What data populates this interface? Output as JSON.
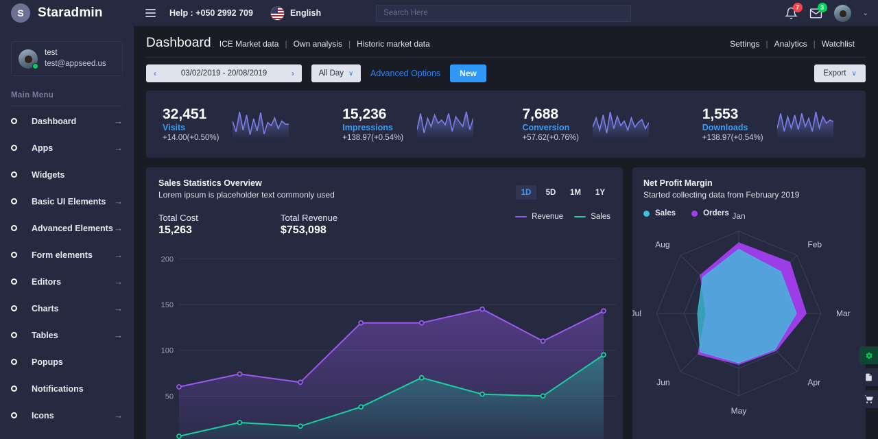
{
  "brand": {
    "logo_letter": "S",
    "name": "Staradmin"
  },
  "profile": {
    "name": "test",
    "email": "test@appseed.us",
    "status": "online"
  },
  "sidebar": {
    "menu_title": "Main Menu",
    "items": [
      {
        "label": "Dashboard",
        "arrow": "→"
      },
      {
        "label": "Apps",
        "arrow": "→"
      },
      {
        "label": "Widgets",
        "arrow": ""
      },
      {
        "label": "Basic UI Elements",
        "arrow": "→"
      },
      {
        "label": "Advanced Elements",
        "arrow": "→"
      },
      {
        "label": "Form elements",
        "arrow": "→"
      },
      {
        "label": "Editors",
        "arrow": "→"
      },
      {
        "label": "Charts",
        "arrow": "→"
      },
      {
        "label": "Tables",
        "arrow": "→"
      },
      {
        "label": "Popups",
        "arrow": ""
      },
      {
        "label": "Notifications",
        "arrow": ""
      },
      {
        "label": "Icons",
        "arrow": "→"
      }
    ]
  },
  "topbar": {
    "help": "Help : +050 2992 709",
    "language": "English",
    "search_placeholder": "Search Here",
    "search_value": "",
    "notifications_count": "7",
    "messages_count": "3",
    "caret": "⌄"
  },
  "page": {
    "title": "Dashboard",
    "breadcrumbs": [
      "ICE Market data",
      "Own analysis",
      "Historic market data"
    ],
    "separator": "|",
    "links": [
      "Settings",
      "Analytics",
      "Watchlist"
    ]
  },
  "toolbar": {
    "prev": "‹",
    "next": "›",
    "date_range": "03/02/2019 - 20/08/2019",
    "all_day": "All Day",
    "advanced_options": "Advanced Options",
    "new_button": "New",
    "export": "Export",
    "caret": "∨"
  },
  "stats": [
    {
      "value": "32,451",
      "label": "Visits",
      "delta": "+14.00(+0.50%)",
      "spark": [
        22,
        8,
        34,
        10,
        30,
        4,
        25,
        9,
        33,
        5,
        20,
        16,
        26,
        12,
        22,
        18,
        18
      ]
    },
    {
      "value": "15,236",
      "label": "Impressions",
      "delta": "+138.97(+0.54%)",
      "spark": [
        10,
        30,
        6,
        24,
        14,
        28,
        18,
        22,
        16,
        30,
        8,
        26,
        20,
        14,
        32,
        10,
        24
      ]
    },
    {
      "value": "7,688",
      "label": "Conversion",
      "delta": "+57.62(+0.76%)",
      "spark": [
        14,
        26,
        10,
        30,
        6,
        34,
        12,
        28,
        16,
        22,
        10,
        26,
        14,
        20,
        24,
        12,
        20
      ]
    },
    {
      "value": "1,553",
      "label": "Downloads",
      "delta": "+138.97(+0.54%)",
      "spark": [
        12,
        30,
        8,
        26,
        12,
        28,
        10,
        30,
        14,
        24,
        8,
        32,
        12,
        26,
        18,
        22,
        20
      ]
    }
  ],
  "sales_card": {
    "title": "Sales Statistics Overview",
    "subtitle": "Lorem ipsum is placeholder text commonly used",
    "range_tabs": [
      "1D",
      "5D",
      "1M",
      "1Y"
    ],
    "active_tab": "1D",
    "total_cost_label": "Total Cost",
    "total_cost_value": "15,263",
    "total_revenue_label": "Total Revenue",
    "total_revenue_value": "$753,098",
    "legend": [
      {
        "name": "Revenue",
        "color": "#9b59f0"
      },
      {
        "name": "Sales",
        "color": "#1bcfa0"
      }
    ]
  },
  "profit_card": {
    "title": "Net Profit Margin",
    "subtitle": "Started collecting data from February 2019",
    "legend": [
      {
        "name": "Sales",
        "color": "#3fbfd8"
      },
      {
        "name": "Orders",
        "color": "#a23ef0"
      }
    ]
  },
  "float_buttons": [
    {
      "name": "settings",
      "icon": "⚙",
      "active": true
    },
    {
      "name": "document",
      "icon": "὜E",
      "active": false
    },
    {
      "name": "cart",
      "icon": "Ὥ2",
      "active": false
    }
  ],
  "chart_data": [
    {
      "type": "area",
      "title": "Sales Statistics Overview",
      "subtitle": "Lorem ipsum is placeholder text commonly used",
      "xlabel": "",
      "ylabel": "",
      "ylim": [
        0,
        225
      ],
      "yticks": [
        50,
        100,
        150,
        200
      ],
      "grid": true,
      "legend_position": "top-right",
      "x": [
        1,
        2,
        3,
        4,
        5,
        6,
        7,
        8
      ],
      "series": [
        {
          "name": "Revenue",
          "color": "#9b59f0",
          "values": [
            60,
            74,
            65,
            130,
            130,
            145,
            110,
            143
          ]
        },
        {
          "name": "Sales",
          "color": "#1bcfa0",
          "values": [
            6,
            21,
            17,
            38,
            70,
            52,
            50,
            95
          ]
        }
      ]
    },
    {
      "type": "radar",
      "title": "Net Profit Margin",
      "subtitle": "Started collecting data from February 2019",
      "categories": [
        "Jan",
        "Feb",
        "Mar",
        "Apr",
        "May",
        "Jun",
        "Jul",
        "Aug"
      ],
      "rmax": 100,
      "rings": 3,
      "grid": true,
      "legend_position": "top-left",
      "series": [
        {
          "name": "Sales",
          "color": "#3fbfd8",
          "values": [
            78,
            72,
            70,
            62,
            60,
            66,
            50,
            62
          ]
        },
        {
          "name": "Orders",
          "color": "#a23ef0",
          "values": [
            86,
            88,
            82,
            64,
            62,
            70,
            40,
            66
          ]
        }
      ]
    }
  ]
}
